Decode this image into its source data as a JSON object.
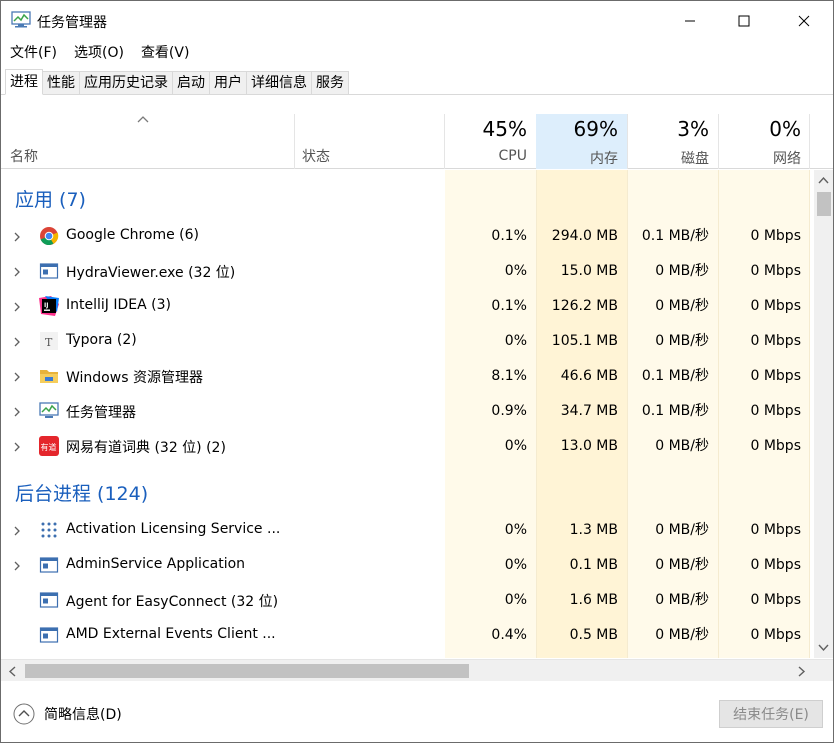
{
  "window": {
    "title": "任务管理器"
  },
  "menu": [
    "文件(F)",
    "选项(O)",
    "查看(V)"
  ],
  "tabs": [
    "进程",
    "性能",
    "应用历史记录",
    "启动",
    "用户",
    "详细信息",
    "服务"
  ],
  "columns": {
    "name": "名称",
    "status": "状态",
    "cpu": {
      "pct": "45%",
      "label": "CPU"
    },
    "memory": {
      "pct": "69%",
      "label": "内存"
    },
    "disk": {
      "pct": "3%",
      "label": "磁盘"
    },
    "network": {
      "pct": "0%",
      "label": "网络"
    }
  },
  "groups": {
    "apps": "应用 (7)",
    "background": "后台进程 (124)"
  },
  "apps": [
    {
      "name": "Google Chrome (6)",
      "icon": "chrome-icon",
      "cpu": "0.1%",
      "mem": "294.0 MB",
      "disk": "0.1 MB/秒",
      "net": "0 Mbps",
      "expandable": true
    },
    {
      "name": "HydraViewer.exe (32 位)",
      "icon": "window-app-icon",
      "cpu": "0%",
      "mem": "15.0 MB",
      "disk": "0 MB/秒",
      "net": "0 Mbps",
      "expandable": true
    },
    {
      "name": "IntelliJ IDEA (3)",
      "icon": "intellij-icon",
      "cpu": "0.1%",
      "mem": "126.2 MB",
      "disk": "0 MB/秒",
      "net": "0 Mbps",
      "expandable": true
    },
    {
      "name": "Typora (2)",
      "icon": "typora-icon",
      "cpu": "0%",
      "mem": "105.1 MB",
      "disk": "0 MB/秒",
      "net": "0 Mbps",
      "expandable": true
    },
    {
      "name": "Windows 资源管理器",
      "icon": "folder-icon",
      "cpu": "8.1%",
      "mem": "46.6 MB",
      "disk": "0.1 MB/秒",
      "net": "0 Mbps",
      "expandable": true
    },
    {
      "name": "任务管理器",
      "icon": "task-manager-icon",
      "cpu": "0.9%",
      "mem": "34.7 MB",
      "disk": "0.1 MB/秒",
      "net": "0 Mbps",
      "expandable": true
    },
    {
      "name": "网易有道词典 (32 位) (2)",
      "icon": "youdao-icon",
      "cpu": "0%",
      "mem": "13.0 MB",
      "disk": "0 MB/秒",
      "net": "0 Mbps",
      "expandable": true
    }
  ],
  "background": [
    {
      "name": "Activation Licensing Service ...",
      "icon": "dots-grid-icon",
      "cpu": "0%",
      "mem": "1.3 MB",
      "disk": "0 MB/秒",
      "net": "0 Mbps",
      "expandable": true
    },
    {
      "name": "AdminService Application",
      "icon": "window-app-icon",
      "cpu": "0%",
      "mem": "0.1 MB",
      "disk": "0 MB/秒",
      "net": "0 Mbps",
      "expandable": true
    },
    {
      "name": "Agent for EasyConnect (32 位)",
      "icon": "window-app-icon",
      "cpu": "0%",
      "mem": "1.6 MB",
      "disk": "0 MB/秒",
      "net": "0 Mbps",
      "expandable": false
    },
    {
      "name": "AMD External Events Client ...",
      "icon": "window-app-icon",
      "cpu": "0.4%",
      "mem": "0.5 MB",
      "disk": "0 MB/秒",
      "net": "0 Mbps",
      "expandable": false
    }
  ],
  "footer": {
    "fewer": "简略信息(D)",
    "end_task": "结束任务(E)"
  }
}
